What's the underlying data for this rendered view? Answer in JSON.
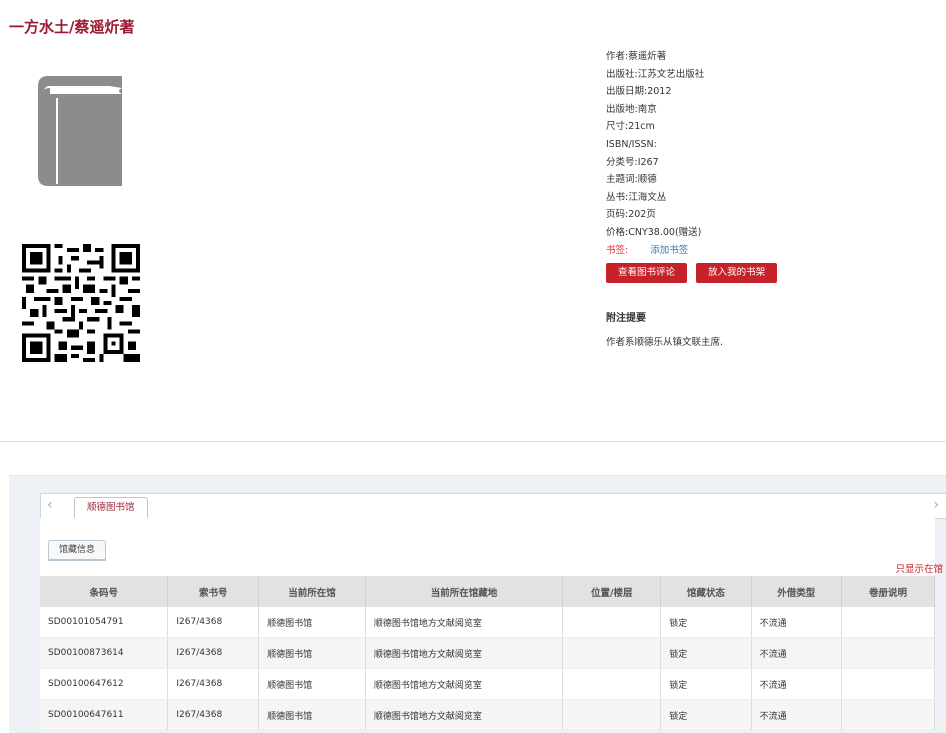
{
  "book": {
    "title": "一方水土/蔡遥炘著"
  },
  "meta": [
    {
      "label": "作者:",
      "value": "蔡遥炘著"
    },
    {
      "label": "出版社:",
      "value": "江苏文艺出版社"
    },
    {
      "label": "出版日期:",
      "value": "2012"
    },
    {
      "label": "出版地:",
      "value": "南京"
    },
    {
      "label": "尺寸:",
      "value": "21cm"
    },
    {
      "label": "ISBN/ISSN:",
      "value": ""
    },
    {
      "label": "分类号:",
      "value": "I267"
    },
    {
      "label": "主题词:",
      "value": "顺德"
    },
    {
      "label": "丛书:",
      "value": "江海文丛"
    },
    {
      "label": "页码:",
      "value": "202页"
    },
    {
      "label": "价格:",
      "value": "CNY38.00(赠送)"
    }
  ],
  "bookmark": {
    "label": "书签:",
    "link": "添加书签"
  },
  "buttons": {
    "review": "查看图书评论",
    "shelf": "放入我的书架"
  },
  "notes": {
    "heading": "附注提要",
    "text": "作者系顺德乐从镇文联主席."
  },
  "holdings": {
    "library_tab": "顺德图书馆",
    "sub_tab": "馆藏信息",
    "only_link": "只显示在馆",
    "columns": [
      "条码号",
      "索书号",
      "当前所在馆",
      "当前所在馆藏地",
      "位置/楼层",
      "馆藏状态",
      "外借类型",
      "卷册说明"
    ],
    "rows": [
      [
        "SD00101054791",
        "I267/4368",
        "顺德图书馆",
        "顺德图书馆地方文献阅览室",
        "",
        "锁定",
        "不流通",
        ""
      ],
      [
        "SD00100873614",
        "I267/4368",
        "顺德图书馆",
        "顺德图书馆地方文献阅览室",
        "",
        "锁定",
        "不流通",
        ""
      ],
      [
        "SD00100647612",
        "I267/4368",
        "顺德图书馆",
        "顺德图书馆地方文献阅览室",
        "",
        "锁定",
        "不流通",
        ""
      ],
      [
        "SD00100647611",
        "I267/4368",
        "顺德图书馆",
        "顺德图书馆地方文献阅览室",
        "",
        "锁定",
        "不流通",
        ""
      ]
    ]
  },
  "icons": {
    "cover": "book-icon",
    "qr": "qr-code-icon",
    "prev": "chevron-left-icon",
    "next": "chevron-right-icon"
  }
}
